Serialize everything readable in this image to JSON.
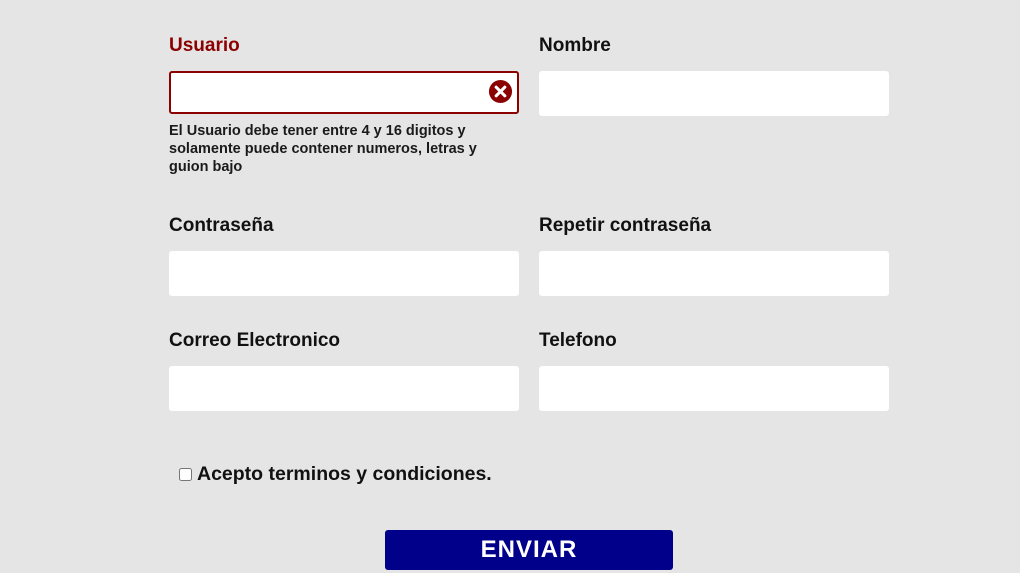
{
  "colors": {
    "background": "#e5e5e5",
    "error": "#8b0000",
    "submit": "#00008b"
  },
  "fields": {
    "usuario": {
      "label": "Usuario",
      "value": "",
      "error": "El Usuario debe tener entre 4 y 16 digitos y solamente puede contener numeros, letras y guion bajo"
    },
    "nombre": {
      "label": "Nombre",
      "value": ""
    },
    "password": {
      "label": "Contraseña",
      "value": ""
    },
    "password2": {
      "label": "Repetir contraseña",
      "value": ""
    },
    "correo": {
      "label": "Correo Electronico",
      "value": ""
    },
    "telefono": {
      "label": "Telefono",
      "value": ""
    }
  },
  "terms": {
    "label": "Acepto terminos y condiciones.",
    "checked": false
  },
  "submit": {
    "label": "ENVIAR"
  },
  "icons": {
    "usuario_error": "error-x-circle-icon"
  }
}
